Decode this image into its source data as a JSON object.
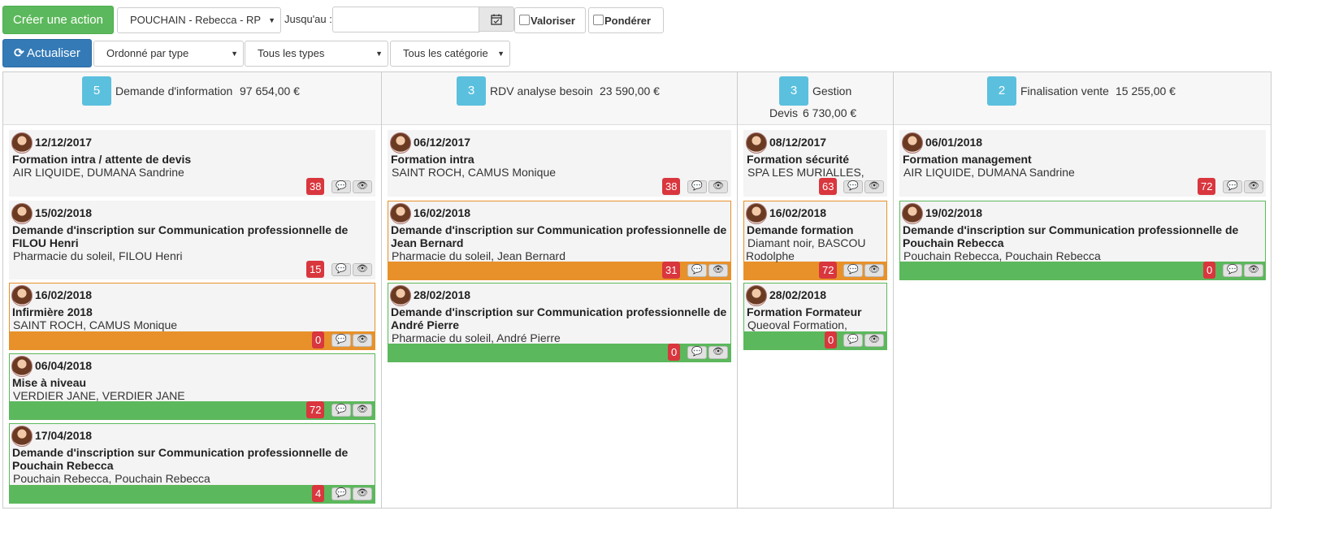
{
  "toolbar": {
    "create_label": "Créer une action",
    "user_select": "POUCHAIN - Rebecca - RP",
    "until_label": "Jusqu'au :",
    "date_value": "",
    "valoriser_label": "Valoriser",
    "ponderer_label": "Pondérer",
    "refresh_label": "Actualiser",
    "order_select": "Ordonné par type",
    "types_select": "Tous les types",
    "categories_select": "Tous les catégorie"
  },
  "colors": {
    "orange": "#e8912a",
    "green": "#5cb85c",
    "red": "#d9363e",
    "count": "#5bc0de"
  },
  "columns": [
    {
      "count": "5",
      "title": "Demande d'information",
      "amount": "97 654,00 €",
      "cards": [
        {
          "date": "12/12/2017",
          "title": "Formation intra / attente de devis",
          "sub": "AIR LIQUIDE, DUMANA Sandrine",
          "badge": "38"
        },
        {
          "date": "15/02/2018",
          "title": "Demande d'inscription sur Communication professionnelle de FILOU Henri",
          "sub": "Pharmacie du soleil, FILOU Henri",
          "badge": "15"
        },
        {
          "date": "16/02/2018",
          "title": "Infirmière 2018",
          "sub": "SAINT ROCH, CAMUS Monique",
          "badge": "0"
        },
        {
          "date": "06/04/2018",
          "title": "Mise à niveau",
          "sub": "VERDIER JANE, VERDIER JANE",
          "badge": "72"
        },
        {
          "date": "17/04/2018",
          "title": "Demande d'inscription sur Communication professionnelle de Pouchain Rebecca",
          "sub": "Pouchain Rebecca, Pouchain Rebecca",
          "badge": "4"
        }
      ]
    },
    {
      "count": "3",
      "title": "RDV analyse besoin",
      "amount": "23 590,00 €",
      "cards": [
        {
          "date": "06/12/2017",
          "title": "Formation intra",
          "sub": "SAINT ROCH, CAMUS Monique",
          "badge": "38"
        },
        {
          "date": "16/02/2018",
          "title": "Demande d'inscription sur Communication professionnelle de Jean Bernard",
          "sub": "Pharmacie du soleil, Jean Bernard",
          "badge": "31"
        },
        {
          "date": "28/02/2018",
          "title": "Demande d'inscription sur Communication professionnelle de André Pierre",
          "sub": "Pharmacie du soleil, André Pierre",
          "badge": "0"
        }
      ]
    },
    {
      "count": "3",
      "title": "Gestion",
      "line2": "Devis",
      "amount": "6 730,00 €",
      "cards": [
        {
          "date": "08/12/2017",
          "title": "Formation sécurité",
          "sub": "SPA LES MURIALLES,",
          "badge": "63"
        },
        {
          "date": "16/02/2018",
          "title": "Demande formation",
          "sub": "Diamant noir, BASCOU",
          "sub2": "Rodolphe",
          "badge": "72"
        },
        {
          "date": "28/02/2018",
          "title": "Formation Formateur",
          "sub": "Queoval Formation,",
          "badge": "0"
        }
      ]
    },
    {
      "count": "2",
      "title": "Finalisation vente",
      "amount": "15 255,00 €",
      "cards": [
        {
          "date": "06/01/2018",
          "title": "Formation management",
          "sub": "AIR LIQUIDE, DUMANA Sandrine",
          "badge": "72"
        },
        {
          "date": "19/02/2018",
          "title": "Demande d'inscription sur Communication professionnelle de Pouchain Rebecca",
          "sub": "Pouchain Rebecca, Pouchain Rebecca",
          "badge": "0"
        }
      ]
    }
  ]
}
